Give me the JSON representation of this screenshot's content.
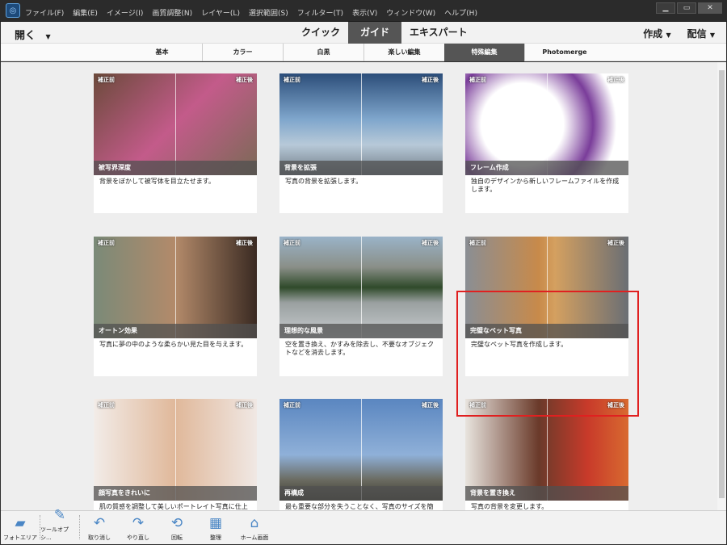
{
  "menu": [
    "ファイル(F)",
    "編集(E)",
    "イメージ(I)",
    "画質調整(N)",
    "レイヤー(L)",
    "選択範囲(S)",
    "フィルター(T)",
    "表示(V)",
    "ウィンドウ(W)",
    "ヘルプ(H)"
  ],
  "window_buttons": [
    "▁",
    "▭",
    "✕"
  ],
  "modebar": {
    "open": "開く",
    "modes": [
      "クイック",
      "ガイド",
      "エキスパート"
    ],
    "create": "作成",
    "share": "配信"
  },
  "tabs": [
    "基本",
    "カラー",
    "白黒",
    "楽しい編集",
    "特殊編集",
    "Photomerge"
  ],
  "before": "補正前",
  "after": "補正後",
  "cards": [
    {
      "title": "被写界深度",
      "desc": "背景をぼかして被写体を目立たせます。",
      "bg": "linear-gradient(135deg,#6b4a3a,#c35b8a 50%,#7a6a55)"
    },
    {
      "title": "背景を拡張",
      "desc": "写真の背景を拡張します。",
      "bg": "linear-gradient(#2c4e7a,#7fa6cc 45%,#b7c9d8 70%,#6f7a85)"
    },
    {
      "title": "フレーム作成",
      "desc": "独自のデザインから新しいフレームファイルを作成します。",
      "bg": "radial-gradient(circle at 35% 50%,#fff 35%,#7a3d9a 60%,#fff 80%)"
    },
    {
      "title": "オートン効果",
      "desc": "写真に夢の中のような柔らかい見た目を与えます。",
      "bg": "linear-gradient(90deg,#7a8a78,#b38a6a 50%,#3a2a22)"
    },
    {
      "title": "理想的な風景",
      "desc": "空を置き換え、かすみを除去し、不要なオブジェクトなどを消去します。",
      "bg": "linear-gradient(#9ab3c8,#8a8f88 30%,#2f4a2a 50%,#9aa0a0 65%,#c8ccd0)"
    },
    {
      "title": "完璧なペット写真",
      "desc": "完璧なペット写真を作成します。",
      "bg": "linear-gradient(90deg,#8a8e94,#c88a4a 45%,#d4a060 55%,#6a6e74)"
    },
    {
      "title": "顔写真をきれいに",
      "desc": "肌の質感を調整して美しいポートレイト写真に仕上",
      "bg": "linear-gradient(90deg,#f2ece8,#e0b89a 50%,#f0e8e4)"
    },
    {
      "title": "再構成",
      "desc": "最も重要な部分を失うことなく、写真のサイズを簡単",
      "bg": "linear-gradient(#5a86c0,#8fb0d8 55%,#6a6a60 80%,#3a3a30)"
    },
    {
      "title": "背景を置き換え",
      "desc": "写真の背景を変更します。",
      "bg": "linear-gradient(90deg,#e8e4de,#6a3a2a 45%,#c83a2a 75%,#d86a30)"
    }
  ],
  "toolbar": [
    {
      "label": "フォトエリア",
      "icon": "▰"
    },
    {
      "label": "ツールオプシ...",
      "icon": "✎"
    },
    {
      "label": "取り消し",
      "icon": "↶"
    },
    {
      "label": "やり直し",
      "icon": "↷"
    },
    {
      "label": "回転",
      "icon": "⟲"
    },
    {
      "label": "整理",
      "icon": "▦"
    },
    {
      "label": "ホーム画面",
      "icon": "⌂"
    }
  ]
}
